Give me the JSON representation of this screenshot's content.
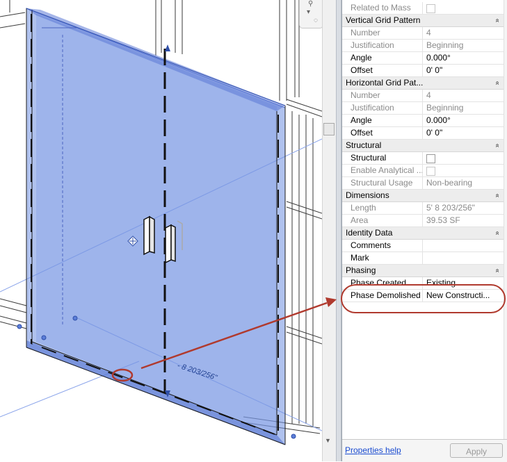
{
  "properties": {
    "rows": [
      {
        "type": "row",
        "name": "Related to Mass",
        "value": "",
        "checkbox": true,
        "disabled": true
      },
      {
        "type": "group",
        "name": "Vertical Grid Pattern"
      },
      {
        "type": "row",
        "name": "Number",
        "value": "4",
        "disabled": true
      },
      {
        "type": "row",
        "name": "Justification",
        "value": "Beginning",
        "disabled": true
      },
      {
        "type": "row",
        "name": "Angle",
        "value": "0.000°",
        "disabled": false
      },
      {
        "type": "row",
        "name": "Offset",
        "value": "0'  0\"",
        "disabled": false
      },
      {
        "type": "group",
        "name": "Horizontal Grid Pat..."
      },
      {
        "type": "row",
        "name": "Number",
        "value": "4",
        "disabled": true
      },
      {
        "type": "row",
        "name": "Justification",
        "value": "Beginning",
        "disabled": true
      },
      {
        "type": "row",
        "name": "Angle",
        "value": "0.000°",
        "disabled": false
      },
      {
        "type": "row",
        "name": "Offset",
        "value": "0'  0\"",
        "disabled": false
      },
      {
        "type": "group",
        "name": "Structural"
      },
      {
        "type": "row",
        "name": "Structural",
        "value": "",
        "checkbox": true,
        "disabled": false
      },
      {
        "type": "row",
        "name": "Enable Analytical ...",
        "value": "",
        "checkbox": true,
        "disabled": true
      },
      {
        "type": "row",
        "name": "Structural Usage",
        "value": "Non-bearing",
        "disabled": true
      },
      {
        "type": "group",
        "name": "Dimensions"
      },
      {
        "type": "row",
        "name": "Length",
        "value": "5'  8 203/256\"",
        "disabled": true
      },
      {
        "type": "row",
        "name": "Area",
        "value": "39.53 SF",
        "disabled": true
      },
      {
        "type": "group",
        "name": "Identity Data"
      },
      {
        "type": "row",
        "name": "Comments",
        "value": "",
        "disabled": false
      },
      {
        "type": "row",
        "name": "Mark",
        "value": "",
        "disabled": false
      },
      {
        "type": "group",
        "name": "Phasing"
      },
      {
        "type": "row",
        "name": "Phase Created",
        "value": "Existing",
        "disabled": false
      },
      {
        "type": "row",
        "name": "Phase Demolished",
        "value": "New Constructi...",
        "disabled": false
      }
    ],
    "collapse_glyph": "double-chevron-up-icon",
    "footer": {
      "help_link": "Properties help",
      "apply_label": "Apply"
    }
  },
  "viewport": {
    "dimension_label": "- 8 203/256\"",
    "selection_color": "#6f8fe0",
    "callout_color": "#b03a2e"
  }
}
